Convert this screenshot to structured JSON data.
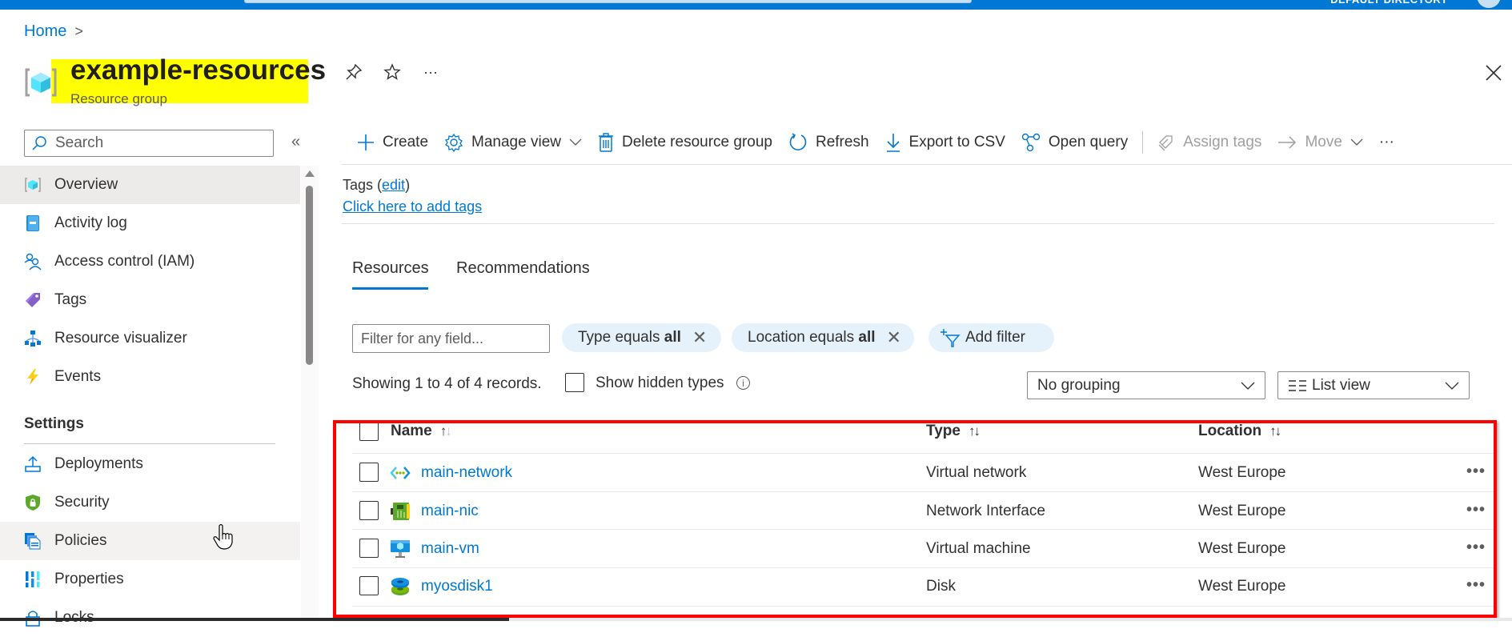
{
  "top_bar": {
    "directory_label": "DEFAULT DIRECTORY"
  },
  "breadcrumb": {
    "home": "Home",
    "separator": ">"
  },
  "header": {
    "title": "example-resources",
    "subtitle": "Resource group",
    "icons": [
      "pin-icon",
      "star-icon",
      "more-icon",
      "close-icon"
    ],
    "more_glyph": "···"
  },
  "sidebar": {
    "search_placeholder": "Search",
    "collapse_glyph": "«",
    "items": [
      {
        "label": "Overview",
        "icon": "resource-group-icon",
        "selected": true
      },
      {
        "label": "Activity log",
        "icon": "activity-log-icon"
      },
      {
        "label": "Access control (IAM)",
        "icon": "iam-icon"
      },
      {
        "label": "Tags",
        "icon": "tag-icon"
      },
      {
        "label": "Resource visualizer",
        "icon": "visualizer-icon"
      },
      {
        "label": "Events",
        "icon": "lightning-icon"
      }
    ],
    "settings_heading": "Settings",
    "settings_items": [
      {
        "label": "Deployments",
        "icon": "upload-icon"
      },
      {
        "label": "Security",
        "icon": "shield-icon"
      },
      {
        "label": "Policies",
        "icon": "policy-icon",
        "hovered": true
      },
      {
        "label": "Properties",
        "icon": "properties-icon"
      },
      {
        "label": "Locks",
        "icon": "lock-icon"
      }
    ]
  },
  "toolbar": {
    "create": "Create",
    "manage_view": "Manage view",
    "delete": "Delete resource group",
    "refresh": "Refresh",
    "export": "Export to CSV",
    "open_query": "Open query",
    "assign_tags": "Assign tags",
    "move": "Move",
    "more_glyph": "···"
  },
  "tags": {
    "label": "Tags",
    "edit_link": "edit",
    "add_link": "Click here to add tags"
  },
  "tabs": [
    {
      "label": "Resources",
      "active": true
    },
    {
      "label": "Recommendations",
      "active": false
    }
  ],
  "filters": {
    "input_placeholder": "Filter for any field...",
    "chips": [
      {
        "prefix": "Type equals ",
        "value": "all"
      },
      {
        "prefix": "Location equals ",
        "value": "all"
      }
    ],
    "add_filter": "Add filter"
  },
  "records": {
    "showing": "Showing 1 to 4 of 4 records.",
    "show_hidden": "Show hidden types",
    "info_glyph": "i",
    "grouping": "No grouping",
    "view": "List view"
  },
  "table": {
    "columns": [
      "Name",
      "Type",
      "Location"
    ],
    "rows": [
      {
        "name": "main-network",
        "type": "Virtual network",
        "location": "West Europe",
        "icon": "virtual-network-icon"
      },
      {
        "name": "main-nic",
        "type": "Network Interface",
        "location": "West Europe",
        "icon": "network-interface-icon"
      },
      {
        "name": "main-vm",
        "type": "Virtual machine",
        "location": "West Europe",
        "icon": "virtual-machine-icon"
      },
      {
        "name": "myosdisk1",
        "type": "Disk",
        "location": "West Europe",
        "icon": "disk-icon"
      }
    ],
    "row_more_glyph": "•••"
  },
  "colors": {
    "azure_blue": "#0078d4",
    "highlight": "#ffff00",
    "annotation_red": "#ff0000",
    "chip_bg": "#e6f2fb"
  }
}
